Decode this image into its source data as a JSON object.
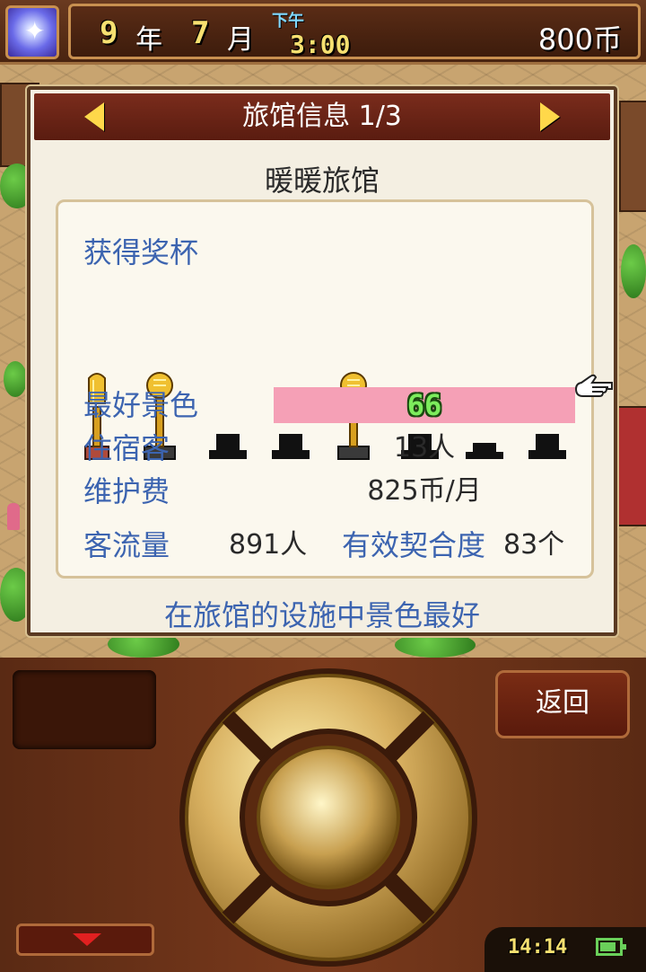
{
  "status_bar": {
    "year_value": "9",
    "year_label": "年",
    "month_value": "7",
    "month_label": "月",
    "time_period": "下午",
    "time": "3:00",
    "money": "800币",
    "menu_icon": "sparkle-gem-icon"
  },
  "dialog": {
    "title": "旅馆信息 1/3",
    "prev_icon": "left-arrow-icon",
    "next_icon": "right-arrow-icon",
    "inn_name": "暖暖旅馆",
    "trophies_label": "获得奖杯",
    "trophies": [
      {
        "state": "earned",
        "style": "tall-gold"
      },
      {
        "state": "earned",
        "style": "gold"
      },
      {
        "state": "empty"
      },
      {
        "state": "empty"
      },
      {
        "state": "earned",
        "style": "gold"
      },
      {
        "state": "empty"
      },
      {
        "state": "empty"
      },
      {
        "state": "empty"
      }
    ],
    "stats": {
      "scenery_label": "最好景色",
      "scenery_value": "66",
      "guests_label": "住宿客",
      "guests_value": "13人",
      "upkeep_label": "维护费",
      "upkeep_value": "825币/月",
      "traffic_label": "客流量",
      "traffic_value": "891人",
      "compat_label": "有效契合度",
      "compat_value": "83个"
    },
    "pointer_icon": "pointing-hand-icon",
    "footer_message": "在旅馆的设施中景色最好"
  },
  "controls": {
    "back_label": "返回",
    "down_icon": "down-arrow-icon",
    "system_time": "14:14",
    "battery_level": 0.85,
    "battery_icon": "battery-icon"
  },
  "colors": {
    "accent_blue": "#3c64b0",
    "scenery_bar": "#f5a0b6",
    "header_red": "#7a2c1c"
  }
}
